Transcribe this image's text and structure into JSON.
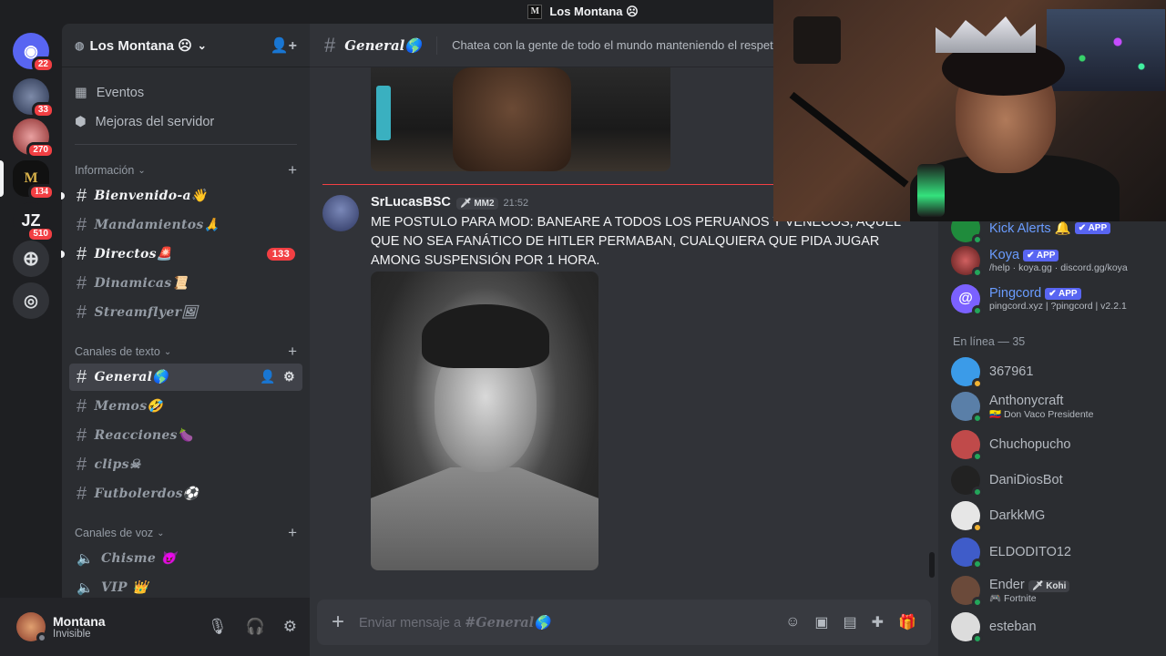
{
  "window": {
    "title": "Los Montana ☹"
  },
  "rail": {
    "servers": [
      {
        "name": "discord-home",
        "badge": "22",
        "color": "#5865f2"
      },
      {
        "name": "server-2",
        "badge": "33",
        "color": "#4a5a7a"
      },
      {
        "name": "server-3",
        "badge": "270",
        "color": "#b34a4a"
      },
      {
        "name": "los-montana",
        "badge": "134",
        "color": "#111111",
        "letter": "M"
      },
      {
        "name": "jz-server",
        "badge": "510",
        "color": "#1e1f22",
        "letter": "JZ"
      }
    ]
  },
  "sidebar": {
    "server_name": "Los Montana ☹",
    "top_items": [
      "Eventos",
      "Mejoras del servidor"
    ],
    "categories": {
      "info": "Información",
      "text": "Canales de texto",
      "voice": "Canales de voz"
    },
    "info_channels": [
      {
        "name": "Bienvenido-a",
        "emoji": "👋"
      },
      {
        "name": "Mandamientos",
        "emoji": "🙏"
      },
      {
        "name": "Directos",
        "emoji": "🚨",
        "count": "133"
      },
      {
        "name": "Dinamicas",
        "emoji": "📜"
      },
      {
        "name": "Streamflyer",
        "emoji": "🖼"
      }
    ],
    "text_channels": [
      {
        "name": "General",
        "emoji": "🌎"
      },
      {
        "name": "Memos",
        "emoji": "🤣"
      },
      {
        "name": "Reacciones",
        "emoji": "🍆"
      },
      {
        "name": "clips",
        "emoji": "☠"
      },
      {
        "name": "Futbolerdos",
        "emoji": "⚽"
      }
    ],
    "voice_channels": [
      {
        "name": "Chisme",
        "emoji": "😈"
      },
      {
        "name": "VIP",
        "emoji": "👑"
      }
    ]
  },
  "user": {
    "name": "Montana",
    "status": "Invisible"
  },
  "chat": {
    "channel": "General",
    "channel_emoji": "🌎",
    "topic": "Chatea con la gente de todo el mundo manteniendo el respeto.",
    "message": {
      "author": "SrLucasBSC",
      "tag": "🗡 MM2",
      "time": "21:52",
      "text": "ME POSTULO PARA MOD: BANEARE A TODOS LOS PERUANOS Y VENECOS, AQUEL QUE NO SEA FANÁTICO DE HITLER PERMABAN, CUALQUIERA QUE PIDA JUGAR AMONG SUSPENSIÓN POR 1 HORA."
    },
    "composer_placeholder_prefix": "Enviar mensaje a ",
    "composer_placeholder_channel": "#General🌎"
  },
  "members": {
    "bots": [
      {
        "name": "Kick Alerts",
        "emoji": "🔔",
        "tag": "✔ APP",
        "sub": ""
      },
      {
        "name": "Koya",
        "tag": "✔ APP",
        "sub": "/help · koya.gg · discord.gg/koya"
      },
      {
        "name": "Pingcord",
        "tag": "✔ APP",
        "sub": "pingcord.xyz | ?pingcord | v2.2.1"
      }
    ],
    "online_header": "En línea — 35",
    "online": [
      {
        "name": "367961",
        "sub": "",
        "color": "#3b9be8",
        "status": "idle"
      },
      {
        "name": "Anthonycraft",
        "sub": "🇪🇨 Don Vaco Presidente",
        "color": "#5a7fa8",
        "status": "online"
      },
      {
        "name": "Chuchopucho",
        "sub": "",
        "color": "#c04a4a",
        "status": "online"
      },
      {
        "name": "DaniDiosBot",
        "sub": "",
        "color": "#222222",
        "status": "online"
      },
      {
        "name": "DarkkMG",
        "sub": "",
        "color": "#e6e6e6",
        "status": "idle"
      },
      {
        "name": "ELDODITO12",
        "sub": "",
        "color": "#3f5cc9",
        "status": "online"
      },
      {
        "name": "Ender",
        "tag": "🗡 Kohi",
        "sub": "🎮 Fortnite",
        "color": "#6b4a3a",
        "status": "online"
      },
      {
        "name": "esteban",
        "sub": "",
        "color": "#dcdcdc",
        "status": "online"
      }
    ]
  },
  "colors": {
    "accent": "#5865f2",
    "danger": "#f23f43",
    "online": "#23a55a",
    "idle": "#f0b232"
  }
}
